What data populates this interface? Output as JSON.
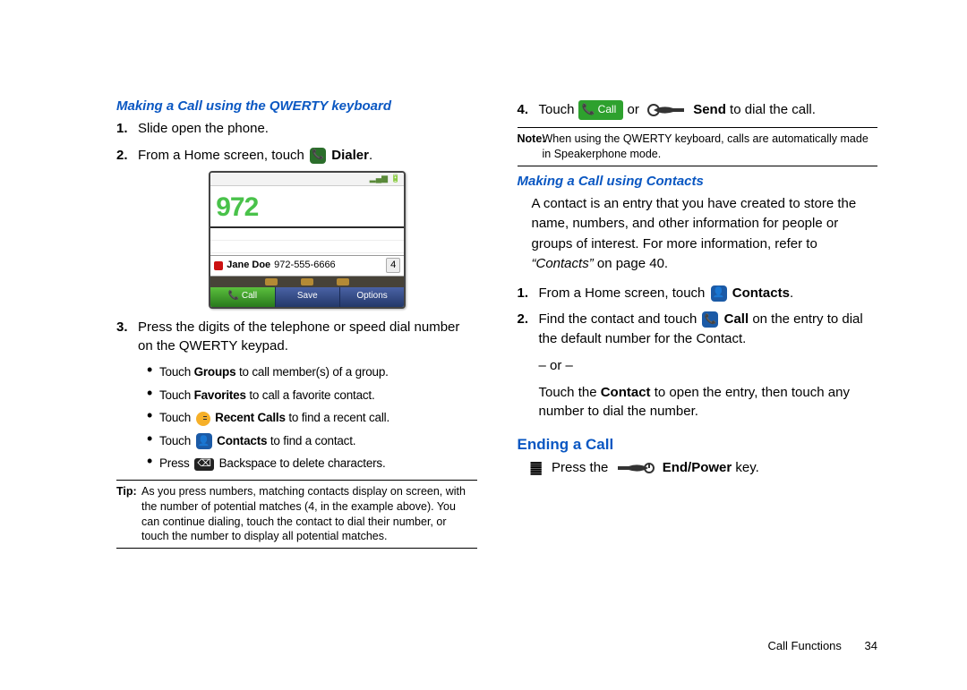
{
  "col1": {
    "heading": "Making a Call using the QWERTY keyboard",
    "step1": "Slide open the phone.",
    "step2_a": "From a Home screen, touch ",
    "step2_b": "Dialer",
    "step2_c": ".",
    "screenshot": {
      "dialed": "972",
      "contact_name": "Jane Doe",
      "contact_number": "972-555-6666",
      "match_count": "4",
      "soft1": "📞  Call",
      "soft2": "Save",
      "soft3": "Options"
    },
    "step3": "Press the digits of the telephone or speed dial number on the QWERTY keypad.",
    "bullets": {
      "b1_a": "Touch ",
      "b1_b": "Groups",
      "b1_c": " to call member(s) of a group.",
      "b2_a": "Touch ",
      "b2_b": "Favorites",
      "b2_c": " to call a favorite contact.",
      "b3_a": "Touch ",
      "b3_b": "Recent Calls",
      "b3_c": " to find a recent call.",
      "b4_a": "Touch ",
      "b4_b": "Contacts",
      "b4_c": " to find a contact.",
      "b5_a": "Press ",
      "b5_b": " Backspace to delete characters."
    },
    "tip_lead": "Tip:",
    "tip_text": "As you press numbers, matching contacts display on screen, with the number of potential matches (4, in the example above). You can continue dialing, touch the contact to dial their number, or touch the number to display all potential matches."
  },
  "col2": {
    "step4_a": "Touch ",
    "step4_call": "Call",
    "step4_b": " or ",
    "step4_c": "Send",
    "step4_d": " to dial the call.",
    "note_lead": "Note:",
    "note_text": "When using the QWERTY keyboard, calls are automatically made in Speakerphone mode.",
    "heading2": "Making a Call using Contacts",
    "para1": "A contact is an entry that you have created to store the name, numbers, and other information for people or groups of interest. For more information, refer to ",
    "para1_ref": "“Contacts”",
    "para1_end": "  on page 40.",
    "c_step1_a": "From a Home screen, touch ",
    "c_step1_b": "Contacts",
    "c_step1_c": ".",
    "c_step2_a": "Find the contact and touch ",
    "c_step2_b": "Call",
    "c_step2_c": " on the entry to dial the default number for the Contact.",
    "c_step2_or": "– or –",
    "c_step2_d": "Touch the ",
    "c_step2_e": "Contact",
    "c_step2_f": " to open the entry, then touch any number to dial the number.",
    "heading3": "Ending a Call",
    "end_a": "Press the ",
    "end_b": "End/Power",
    "end_c": "  key."
  },
  "footer": {
    "section": "Call Functions",
    "page": "34"
  }
}
